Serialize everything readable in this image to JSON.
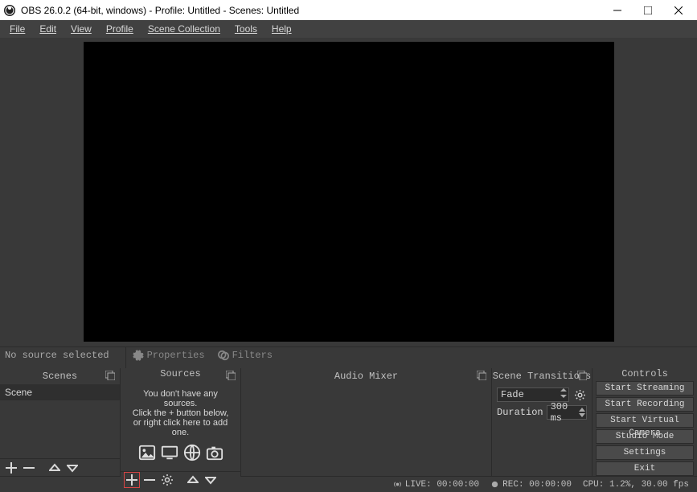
{
  "window": {
    "title": "OBS 26.0.2 (64-bit, windows) - Profile: Untitled - Scenes: Untitled"
  },
  "menu": {
    "file": "File",
    "edit": "Edit",
    "view": "View",
    "profile": "Profile",
    "scene_collection": "Scene Collection",
    "tools": "Tools",
    "help": "Help"
  },
  "toolbar": {
    "no_source": "No source selected",
    "properties": "Properties",
    "filters": "Filters"
  },
  "panels": {
    "scenes": "Scenes",
    "sources": "Sources",
    "audio_mixer": "Audio Mixer",
    "scene_transitions": "Scene Transitions",
    "controls": "Controls"
  },
  "scenes": {
    "items": [
      {
        "name": "Scene"
      }
    ]
  },
  "sources_empty": {
    "line1": "You don't have any sources.",
    "line2": "Click the + button below,",
    "line3": "or right click here to add one."
  },
  "transitions": {
    "selected": "Fade",
    "duration_label": "Duration",
    "duration_value": "300 ms"
  },
  "controls": {
    "start_streaming": "Start Streaming",
    "start_recording": "Start Recording",
    "start_virtual_cam": "Start Virtual Camera",
    "studio_mode": "Studio Mode",
    "settings": "Settings",
    "exit": "Exit"
  },
  "status": {
    "live": "LIVE: 00:00:00",
    "rec": "REC: 00:00:00",
    "cpu": "CPU: 1.2%, 30.00 fps"
  }
}
